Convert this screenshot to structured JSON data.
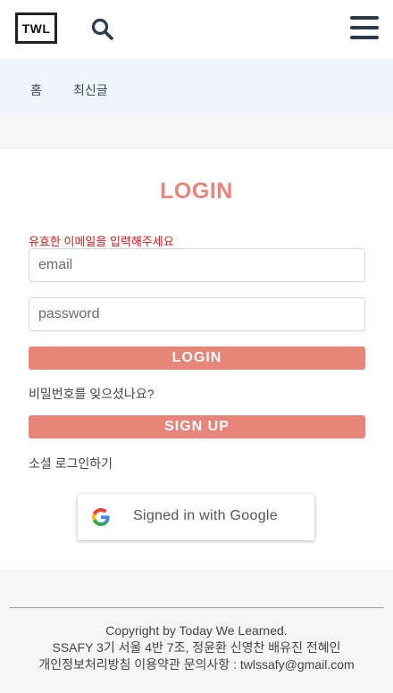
{
  "header": {
    "logo_text": "TWL",
    "search_icon": "search-icon",
    "menu_icon": "hamburger-menu-icon"
  },
  "nav": {
    "items": [
      {
        "label": "홈"
      },
      {
        "label": "최신글"
      }
    ]
  },
  "login": {
    "title": "LOGIN",
    "error_message": "유효한 이메일을 입력해주세요",
    "email_placeholder": "email",
    "email_value": "",
    "password_placeholder": "password",
    "password_value": "",
    "login_button": "LOGIN",
    "forgot_password": "비밀번호를 잊으셨나요?",
    "signup_button": "SIGN UP",
    "social_label": "소셜 로그인하기",
    "google_button": "Signed in with Google"
  },
  "footer": {
    "copyright": "Copyright by Today We Learned.",
    "team": "SSAFY 3기 서울 4반 7조, 정윤환 신영찬 배유진 전혜인",
    "links": "개인정보처리방침 이용약관 문의사항 : twlssafy@gmail.com"
  },
  "colors": {
    "accent": "#e8857a",
    "error": "#d32020",
    "nav_background": "#eef5fd",
    "page_background": "#f6f6f6"
  }
}
